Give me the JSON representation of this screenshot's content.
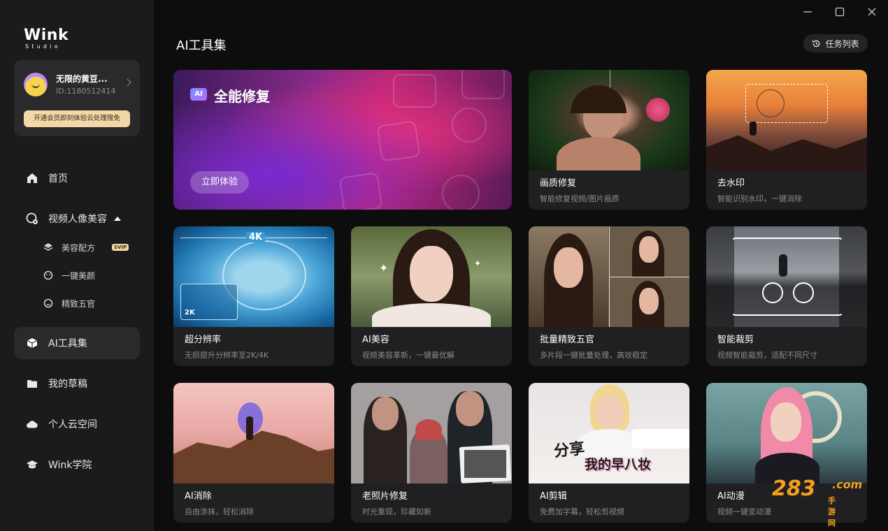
{
  "logo": {
    "main": "Wink",
    "sub": "Studio"
  },
  "user": {
    "name": "无限的黄豆...",
    "id": "ID:1180512414",
    "vip_cta": "开通会员即刻体验云处理限免"
  },
  "nav": {
    "home": "首页",
    "video_beauty": "视频人像美容",
    "sub": [
      {
        "label": "美容配方",
        "badge": "SVIP"
      },
      {
        "label": "一键美颜"
      },
      {
        "label": "精致五官"
      }
    ],
    "ai_tools": "AI工具集",
    "drafts": "我的草稿",
    "cloud": "个人云空间",
    "academy": "Wink学院"
  },
  "header": {
    "title": "AI工具集",
    "task_list": "任务列表"
  },
  "hero": {
    "badge": "AI",
    "title": "全能修复",
    "cta": "立即体验"
  },
  "cards": [
    {
      "title": "画质修复",
      "desc": "智能修复视频/图片画质"
    },
    {
      "title": "去水印",
      "desc": "智能识别水印，一键消除"
    },
    {
      "title": "超分辨率",
      "desc": "无损提升分辨率至2K/4K",
      "tag_big": "4K",
      "tag_small": "2K"
    },
    {
      "title": "AI美容",
      "desc": "视频美容革新，一键最优解"
    },
    {
      "title": "批量精致五官",
      "desc": "多片段一键批量处理，高效稳定"
    },
    {
      "title": "智能裁剪",
      "desc": "视频智能裁剪，适配不同尺寸"
    },
    {
      "title": "AI消除",
      "desc": "自由涂抹，轻松消除"
    },
    {
      "title": "老照片修复",
      "desc": "时光重现，珍藏如新"
    },
    {
      "title": "AI剪辑",
      "desc": "免费加字幕，轻松剪视频",
      "overlay1": "分享",
      "overlay2": "我的早八妆"
    },
    {
      "title": "AI动漫",
      "desc": "视频一键变动漫"
    }
  ],
  "watermark": {
    "num": "283",
    "com": ".com",
    "cn": "手游网"
  }
}
